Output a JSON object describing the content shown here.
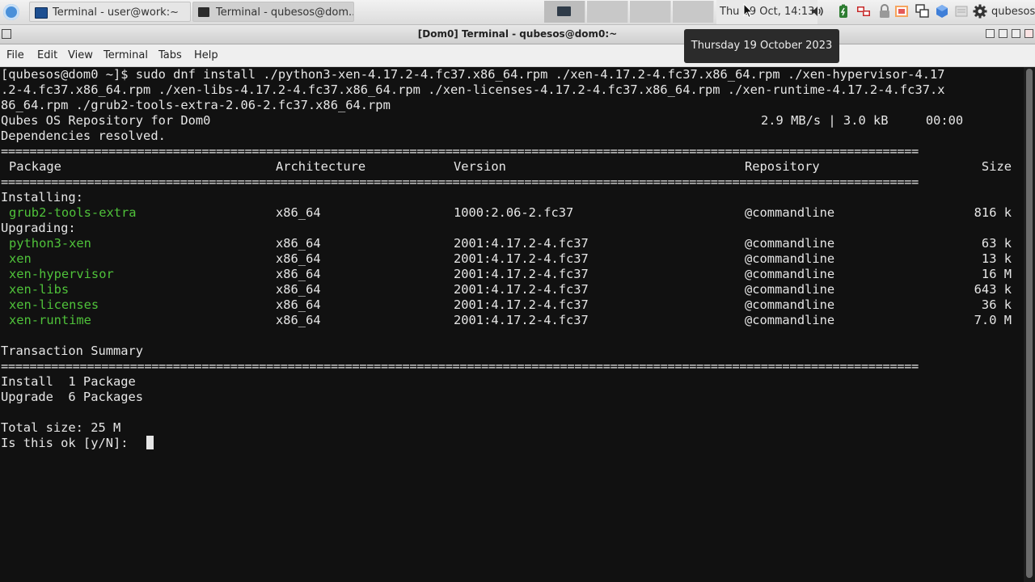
{
  "taskbar": {
    "tasks": [
      {
        "label": "Terminal - user@work:~"
      },
      {
        "label": "Terminal - qubesos@dom..."
      }
    ],
    "clock": "Thu 19 Oct, 14:13",
    "user": "qubesos"
  },
  "tooltip": "Thursday 19 October 2023",
  "window": {
    "title": "[Dom0] Terminal - qubesos@dom0:~"
  },
  "menubar": [
    "File",
    "Edit",
    "View",
    "Terminal",
    "Tabs",
    "Help"
  ],
  "terminal": {
    "command_lines": [
      "[qubesos@dom0 ~]$ sudo dnf install ./python3-xen-4.17.2-4.fc37.x86_64.rpm ./xen-4.17.2-4.fc37.x86_64.rpm ./xen-hypervisor-4.17",
      ".2-4.fc37.x86_64.rpm ./xen-libs-4.17.2-4.fc37.x86_64.rpm ./xen-licenses-4.17.2-4.fc37.x86_64.rpm ./xen-runtime-4.17.2-4.fc37.x",
      "86_64.rpm ./grub2-tools-extra-2.06-2.fc37.x86_64.rpm"
    ],
    "repo_line": "Qubes OS Repository for Dom0",
    "repo_stats": "2.9 MB/s | 3.0 kB     00:00",
    "deps": "Dependencies resolved.",
    "separator": "================================================================================================================================",
    "headers": {
      "package": "Package",
      "arch": "Architecture",
      "version": "Version",
      "repo": "Repository",
      "size": "Size"
    },
    "installing_label": "Installing:",
    "installing": [
      {
        "package": "grub2-tools-extra",
        "arch": "x86_64",
        "version": "1000:2.06-2.fc37",
        "repo": "@commandline",
        "size": "816 k"
      }
    ],
    "upgrading_label": "Upgrading:",
    "upgrading": [
      {
        "package": "python3-xen",
        "arch": "x86_64",
        "version": "2001:4.17.2-4.fc37",
        "repo": "@commandline",
        "size": "63 k"
      },
      {
        "package": "xen",
        "arch": "x86_64",
        "version": "2001:4.17.2-4.fc37",
        "repo": "@commandline",
        "size": "13 k"
      },
      {
        "package": "xen-hypervisor",
        "arch": "x86_64",
        "version": "2001:4.17.2-4.fc37",
        "repo": "@commandline",
        "size": "16 M"
      },
      {
        "package": "xen-libs",
        "arch": "x86_64",
        "version": "2001:4.17.2-4.fc37",
        "repo": "@commandline",
        "size": "643 k"
      },
      {
        "package": "xen-licenses",
        "arch": "x86_64",
        "version": "2001:4.17.2-4.fc37",
        "repo": "@commandline",
        "size": "36 k"
      },
      {
        "package": "xen-runtime",
        "arch": "x86_64",
        "version": "2001:4.17.2-4.fc37",
        "repo": "@commandline",
        "size": "7.0 M"
      }
    ],
    "summary_label": "Transaction Summary",
    "install_summary": "Install  1 Package",
    "upgrade_summary": "Upgrade  6 Packages",
    "total_size": "Total size: 25 M",
    "prompt": "Is this ok [y/N]: "
  }
}
